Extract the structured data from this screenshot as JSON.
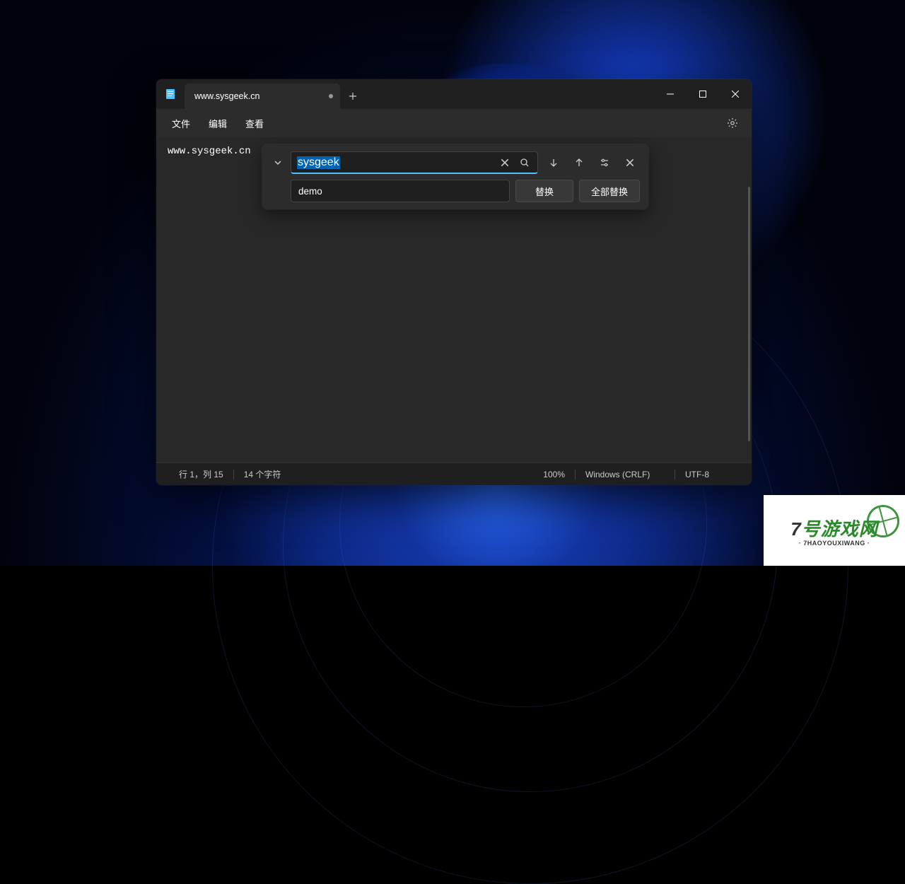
{
  "tab": {
    "title": "www.sysgeek.cn"
  },
  "menu": {
    "file": "文件",
    "edit": "编辑",
    "view": "查看"
  },
  "editor": {
    "content": "www.sysgeek.cn"
  },
  "find": {
    "search_value": "sysgeek",
    "replace_value": "demo",
    "replace_btn": "替换",
    "replace_all_btn": "全部替换"
  },
  "status": {
    "cursor": "行 1，列 15",
    "chars": "14 个字符",
    "zoom": "100%",
    "line_ending": "Windows (CRLF)",
    "encoding": "UTF-8"
  },
  "watermark": {
    "line1_prefix": "7",
    "line1_rest": "号游戏网",
    "line2": "· 7HAOYOUXIWANG ·"
  }
}
